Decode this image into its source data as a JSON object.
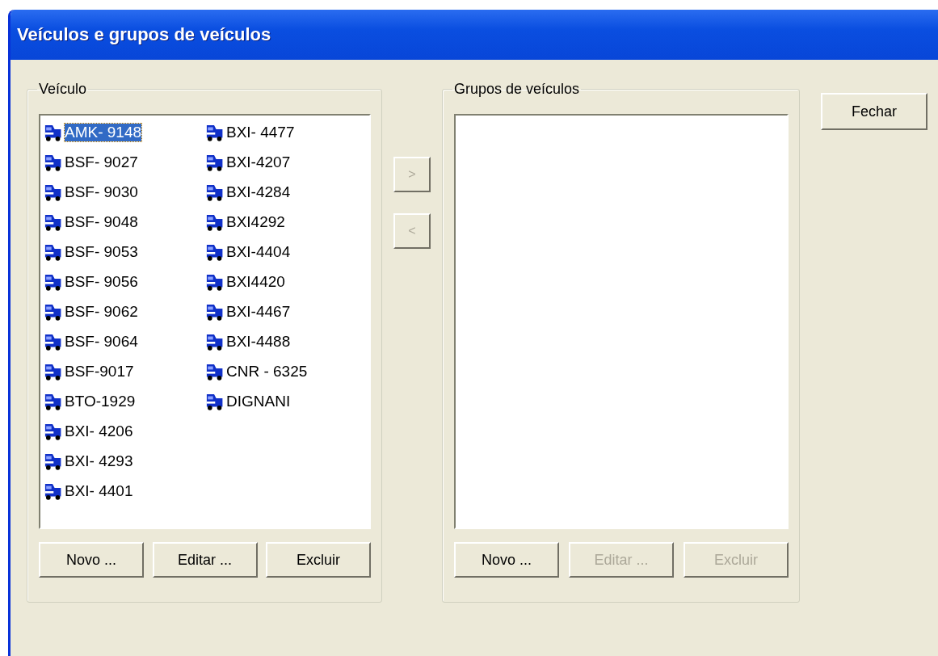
{
  "window": {
    "title": "Veículos e grupos de veículos"
  },
  "vehicles": {
    "label": "Veículo",
    "items": [
      {
        "name": "AMK- 9148",
        "selected": true
      },
      {
        "name": "BSF- 9027",
        "selected": false
      },
      {
        "name": "BSF- 9030",
        "selected": false
      },
      {
        "name": "BSF- 9048",
        "selected": false
      },
      {
        "name": "BSF- 9053",
        "selected": false
      },
      {
        "name": "BSF- 9056",
        "selected": false
      },
      {
        "name": "BSF- 9062",
        "selected": false
      },
      {
        "name": "BSF- 9064",
        "selected": false
      },
      {
        "name": "BSF-9017",
        "selected": false
      },
      {
        "name": "BTO-1929",
        "selected": false
      },
      {
        "name": "BXI- 4206",
        "selected": false
      },
      {
        "name": "BXI- 4293",
        "selected": false
      },
      {
        "name": "BXI- 4401",
        "selected": false
      },
      {
        "name": "BXI- 4477",
        "selected": false
      },
      {
        "name": "BXI-4207",
        "selected": false
      },
      {
        "name": "BXI-4284",
        "selected": false
      },
      {
        "name": "BXI4292",
        "selected": false
      },
      {
        "name": "BXI-4404",
        "selected": false
      },
      {
        "name": "BXI4420",
        "selected": false
      },
      {
        "name": "BXI-4467",
        "selected": false
      },
      {
        "name": "BXI-4488",
        "selected": false
      },
      {
        "name": "CNR - 6325",
        "selected": false
      },
      {
        "name": "DIGNANI",
        "selected": false
      }
    ],
    "buttons": [
      {
        "label": "Novo ...",
        "disabled": false
      },
      {
        "label": "Editar ...",
        "disabled": false
      },
      {
        "label": "Excluir",
        "disabled": false
      }
    ]
  },
  "transfer_buttons": [
    {
      "label": ">",
      "disabled": true
    },
    {
      "label": "<",
      "disabled": true
    }
  ],
  "groups": {
    "label": "Grupos de veículos",
    "buttons": [
      {
        "label": "Novo ...",
        "disabled": false
      },
      {
        "label": "Editar ...",
        "disabled": true
      },
      {
        "label": "Excluir",
        "disabled": true
      }
    ]
  },
  "close_button": {
    "label": "Fechar",
    "disabled": false
  }
}
